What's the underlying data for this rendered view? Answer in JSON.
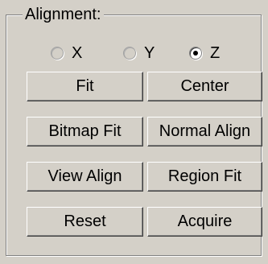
{
  "group": {
    "label": "Alignment:"
  },
  "axis_options": [
    {
      "label": "X",
      "state": "unselected"
    },
    {
      "label": "Y",
      "state": "unselected"
    },
    {
      "label": "Z",
      "state": "selected"
    }
  ],
  "buttons": {
    "fit": "Fit",
    "center": "Center",
    "bitmap_fit": "Bitmap Fit",
    "normal_align": "Normal Align",
    "view_align": "View Align",
    "region_fit": "Region Fit",
    "reset": "Reset",
    "acquire": "Acquire"
  }
}
